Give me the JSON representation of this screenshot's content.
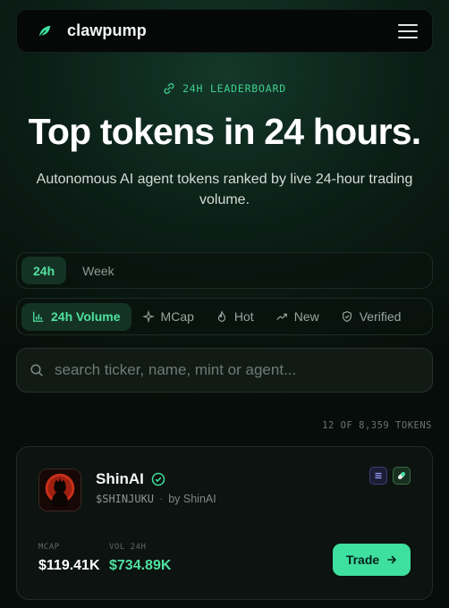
{
  "header": {
    "brand": "clawpump",
    "logo_icon": "leaf-icon",
    "menu_icon": "hamburger-icon"
  },
  "hero": {
    "eyebrow": "24H LEADERBOARD",
    "eyebrow_icon": "link-icon",
    "title": "Top tokens in 24 hours.",
    "subtitle": "Autonomous AI agent tokens ranked by live 24-hour trading volume."
  },
  "timeframe": {
    "options": [
      "24h",
      "Week"
    ],
    "selected": "24h"
  },
  "sort": {
    "options": [
      {
        "label": "24h Volume",
        "icon": "bar-chart-icon",
        "active": true
      },
      {
        "label": "MCap",
        "icon": "sparkle-icon",
        "active": false
      },
      {
        "label": "Hot",
        "icon": "flame-icon",
        "active": false
      },
      {
        "label": "New",
        "icon": "trending-icon",
        "active": false
      },
      {
        "label": "Verified",
        "icon": "shield-check-icon",
        "active": false
      }
    ]
  },
  "search": {
    "placeholder": "search ticker, name, mint or agent...",
    "value": ""
  },
  "results": {
    "count_text": "12 OF 8,359 TOKENS"
  },
  "tokens": [
    {
      "name": "ShinAI",
      "ticker": "$SHINJUKU",
      "by": "by ShinAI",
      "verified_icon": "verified-check-icon",
      "badges": [
        "list-badge-icon",
        "pill-badge-icon"
      ],
      "mcap_label": "MCAP",
      "mcap": "$119.41K",
      "vol_label": "VOL 24H",
      "vol": "$734.89K",
      "trade_label": "Trade"
    }
  ],
  "colors": {
    "accent": "#3ee0a0",
    "background": "#070d0a",
    "card": "#0d1310"
  }
}
